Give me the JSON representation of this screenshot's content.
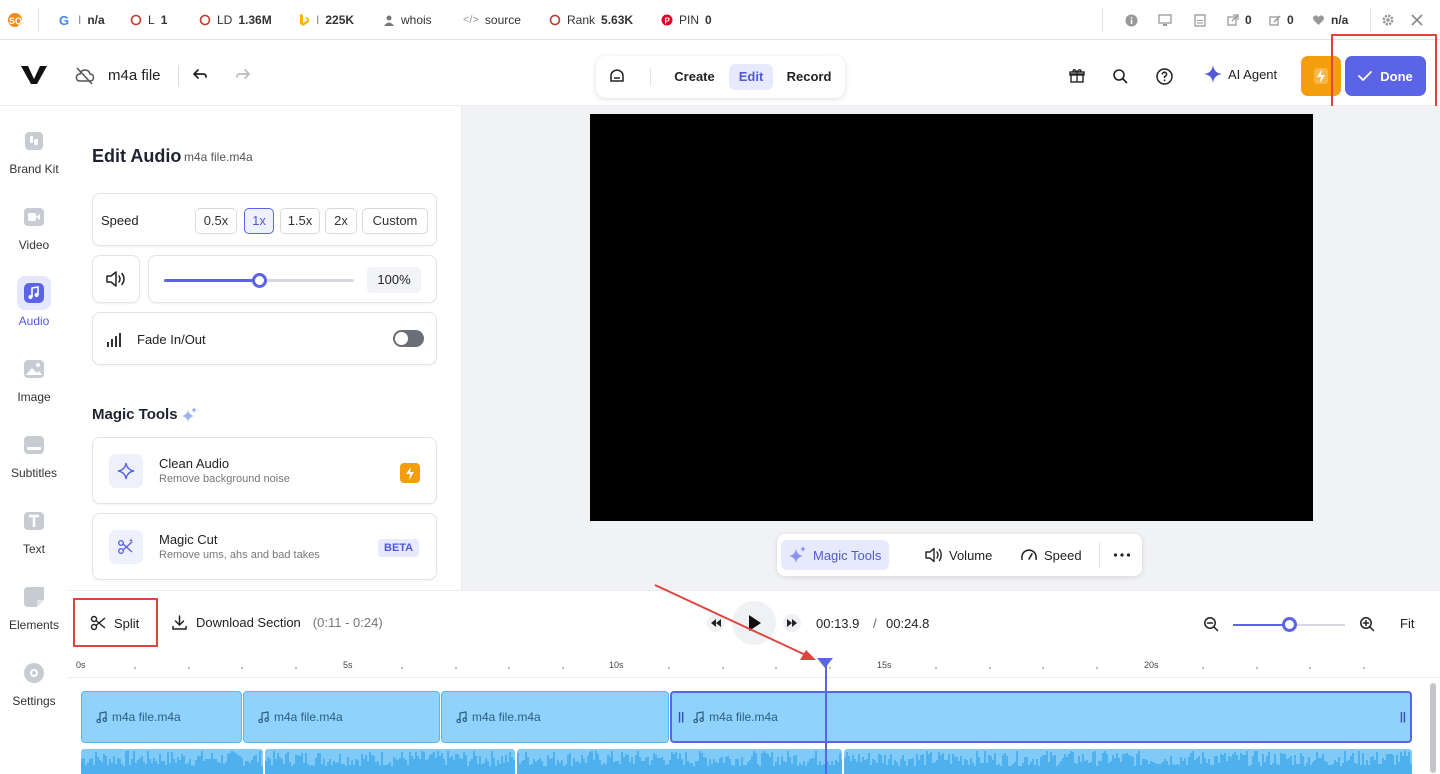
{
  "seo_bar": {
    "google": "n/a",
    "links": "L",
    "links_value": "1",
    "ld": "LD",
    "ld_value": "1.36M",
    "bing": "225K",
    "whois": "whois",
    "source": "source",
    "rank_label": "Rank",
    "rank_value": "5.63K",
    "pin_label": "PIN",
    "pin_value": "0",
    "ext_links": "0",
    "int_links": "0",
    "score": "n/a"
  },
  "header": {
    "file_name": "m4a file",
    "modes": [
      "Create",
      "Edit",
      "Record"
    ],
    "active_mode": "Edit",
    "ai_agent": "AI Agent",
    "done": "Done"
  },
  "rail": [
    {
      "label": "Brand Kit",
      "icon": "brand-kit-icon"
    },
    {
      "label": "Video",
      "icon": "video-icon"
    },
    {
      "label": "Audio",
      "icon": "music-note-icon",
      "active": true
    },
    {
      "label": "Image",
      "icon": "image-icon"
    },
    {
      "label": "Subtitles",
      "icon": "subtitles-icon"
    },
    {
      "label": "Text",
      "icon": "text-icon"
    },
    {
      "label": "Elements",
      "icon": "elements-icon"
    },
    {
      "label": "Settings",
      "icon": "settings-icon"
    }
  ],
  "panel": {
    "title": "Edit Audio",
    "subtitle": "m4a file.m4a",
    "speed_label": "Speed",
    "speed_options": [
      "0.5x",
      "1x",
      "1.5x",
      "2x",
      "Custom"
    ],
    "speed_selected": "1x",
    "volume_value": "100%",
    "volume_level": 0.5,
    "fade_label": "Fade In/Out",
    "fade_on": false,
    "magic_title": "Magic Tools",
    "tools": [
      {
        "name": "Clean Audio",
        "desc": "Remove background noise",
        "badge": ""
      },
      {
        "name": "Magic Cut",
        "desc": "Remove ums, ahs and bad takes",
        "badge": "BETA"
      }
    ]
  },
  "preview_toolbar": {
    "magic_tools": "Magic Tools",
    "volume": "Volume",
    "speed": "Speed"
  },
  "timeline": {
    "split": "Split",
    "download": "Download Section",
    "range": "(0:11 - 0:24)",
    "current_time": "00:13.9",
    "separator": "/",
    "total_time": "00:24.8",
    "fit": "Fit",
    "zoom_level": 0.5,
    "ruler": [
      "0s",
      "5s",
      "10s",
      "15s",
      "20s"
    ],
    "clips": [
      "m4a file.m4a",
      "m4a file.m4a",
      "m4a file.m4a",
      "m4a file.m4a"
    ]
  },
  "colors": {
    "accent": "#5b63e6",
    "done_bg": "#5b63e6",
    "bolt_bg": "#f59e0b",
    "clip_bg": "#8fd3fb",
    "annotation": "#e0443e"
  }
}
